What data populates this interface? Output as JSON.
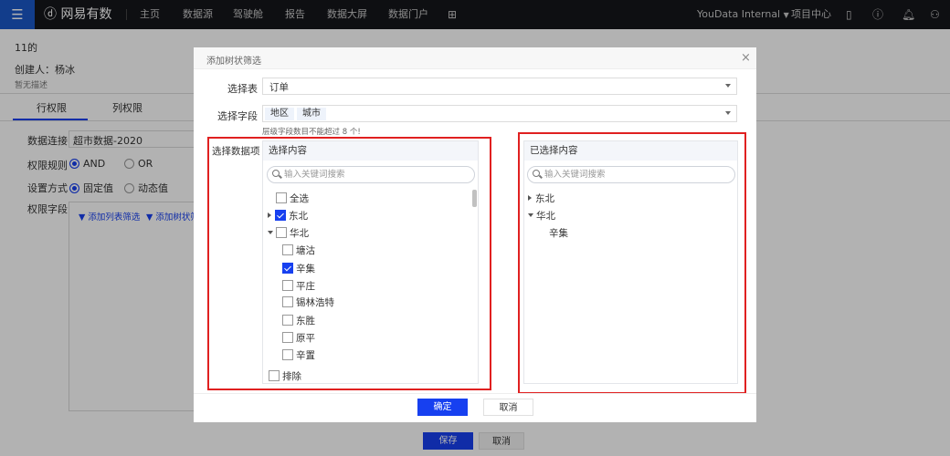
{
  "topbar": {
    "logo": "网易有数",
    "nav": [
      "主页",
      "数据源",
      "驾驶舱",
      "报告",
      "数据大屏",
      "数据门户"
    ],
    "org": "YouData Internal",
    "project_center": "项目中心",
    "icons": [
      "menu-icon",
      "add-screen-icon",
      "mobile-icon",
      "help-icon",
      "bell-icon",
      "user-icon"
    ]
  },
  "page": {
    "title": "11的",
    "creator": "创建人：杨冰",
    "description": "暂无描述",
    "tabs": [
      "行权限",
      "列权限"
    ],
    "active_tab": "行权限",
    "form": {
      "connection_label": "数据连接",
      "connection_value": "超市数据-2020",
      "rule_label": "权限规则",
      "rule_options": [
        "AND",
        "OR"
      ],
      "rule_selected": "AND",
      "mode_label": "设置方式",
      "mode_options": [
        "固定值",
        "动态值"
      ],
      "mode_selected": "固定值",
      "field_label": "权限字段",
      "add_list_filter": "添加列表筛选",
      "add_tree_filter": "添加树状筛"
    },
    "save": "保存",
    "cancel": "取消"
  },
  "modal": {
    "title": "添加树状筛选",
    "table_label": "选择表",
    "table_value": "订单",
    "field_label": "选择字段",
    "field_tags": [
      "地区",
      "城市"
    ],
    "hint": "层级字段数目不能超过 8 个!",
    "items_label": "选择数据项",
    "left": {
      "header": "选择内容",
      "search_placeholder": "输入关键词搜索",
      "select_all": "全选",
      "tree": [
        {
          "label": "东北",
          "checked": true,
          "expanded": false
        },
        {
          "label": "华北",
          "checked": false,
          "expanded": true,
          "children": [
            {
              "label": "塘沽",
              "checked": false
            },
            {
              "label": "辛集",
              "checked": true
            },
            {
              "label": "平庄",
              "checked": false
            },
            {
              "label": "锡林浩特",
              "checked": false
            },
            {
              "label": "东胜",
              "checked": false
            },
            {
              "label": "原平",
              "checked": false
            },
            {
              "label": "辛置",
              "checked": false
            }
          ]
        }
      ],
      "exclude": "排除"
    },
    "right": {
      "header": "已选择内容",
      "search_placeholder": "输入关键词搜索",
      "tree": [
        {
          "label": "东北",
          "expanded": false
        },
        {
          "label": "华北",
          "expanded": true,
          "children": [
            "辛集"
          ]
        }
      ]
    },
    "ok": "确定",
    "cancel": "取消"
  },
  "colors": {
    "primary": "#1740f0",
    "topbar": "#15161b",
    "highlight": "#e02020"
  }
}
